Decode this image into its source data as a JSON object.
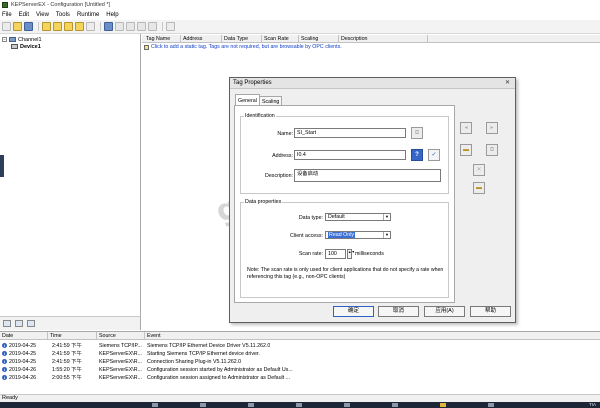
{
  "window": {
    "title": "KEPServerEX - Configuration [Untitled *]"
  },
  "menu": [
    "File",
    "Edit",
    "View",
    "Tools",
    "Runtime",
    "Help"
  ],
  "tree": {
    "channel": "Channel1",
    "device": "Device1"
  },
  "grid": {
    "columns": [
      "Tag Name",
      "Address",
      "Data Type",
      "Scan Rate",
      "Scaling",
      "Description"
    ],
    "hint": "Click to add a static tag.  Tags are not required, but are browsable by OPC clients."
  },
  "dialog": {
    "title": "Tag Properties",
    "close": "✕",
    "tabs": [
      "General",
      "Scaling"
    ],
    "identification": {
      "legend": "Identification",
      "name_label": "Name:",
      "name_value": "SI_Start",
      "address_label": "Address:",
      "address_value": "I0.4",
      "description_label": "Description:",
      "description_value": "设备启动"
    },
    "properties": {
      "legend": "Data properties",
      "data_type_label": "Data type:",
      "data_type_value": "Default",
      "client_access_label": "Client access:",
      "client_access_value": "Read Only",
      "scan_rate_label": "Scan rate:",
      "scan_rate_value": "100",
      "scan_rate_unit": "milliseconds",
      "note": "Note:  The scan rate is only used for client applications that do not specify a rate when referencing this tag (e.g., non-OPC clients)"
    },
    "buttons": {
      "ok": "确定",
      "cancel": "取消",
      "apply": "应用(A)",
      "help": "帮助"
    }
  },
  "watermark": {
    "text": "gongkong",
    "mark": "®"
  },
  "log": {
    "columns": [
      "Date",
      "Time",
      "Source",
      "Event"
    ],
    "rows": [
      {
        "date": "2019-04-25",
        "time": "2:41:59 下午",
        "source": "Siemens TCP/IP...",
        "event": "Siemens TCP/IP Ethernet Device Driver V5.11.262.0"
      },
      {
        "date": "2019-04-25",
        "time": "2:41:59 下午",
        "source": "KEPServerEX\\R...",
        "event": "Starting Siemens TCP/IP Ethernet device driver."
      },
      {
        "date": "2019-04-25",
        "time": "2:41:59 下午",
        "source": "KEPServerEX\\R...",
        "event": "Connection Sharing Plug-in V5.11.262.0"
      },
      {
        "date": "2019-04-26",
        "time": "1:55:20 下午",
        "source": "KEPServerEX\\R...",
        "event": "Configuration session started by Administrator as Default Us..."
      },
      {
        "date": "2019-04-26",
        "time": "2:00:55 下午",
        "source": "KEPServerEX\\R...",
        "event": "Configuration session assigned to Administrator as Default ..."
      }
    ]
  },
  "status": {
    "text": "Ready"
  },
  "tray": {
    "text": "TIA"
  }
}
